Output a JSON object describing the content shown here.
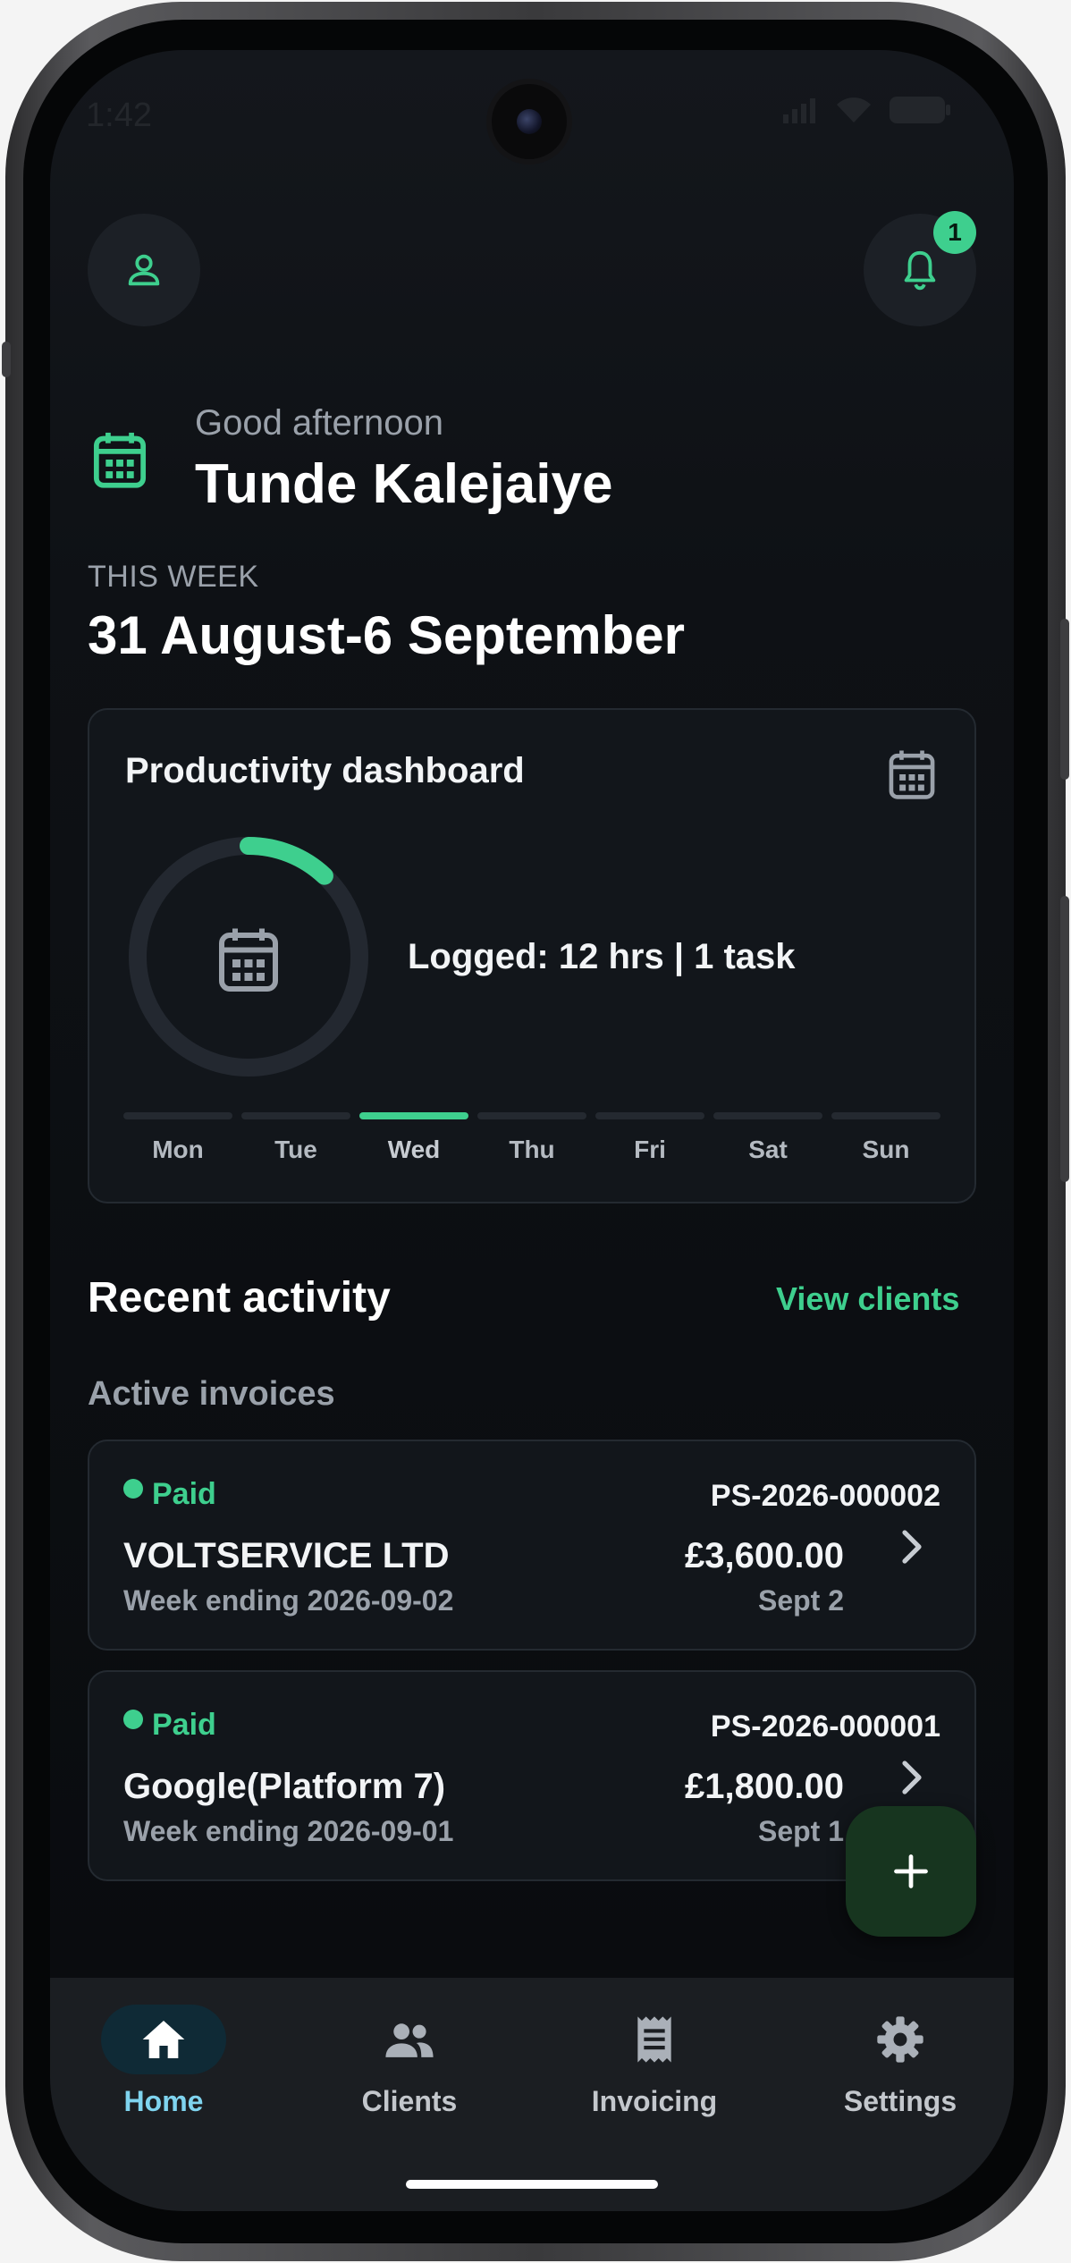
{
  "status": {
    "time": "1:42"
  },
  "header": {
    "notification_count": "1"
  },
  "greeting": {
    "salutation": "Good afternoon",
    "name": "Tunde Kalejaiye"
  },
  "week": {
    "label": "THIS WEEK",
    "range": "31 August-6 September"
  },
  "productivity": {
    "title": "Productivity dashboard",
    "logged_text": "Logged: 12 hrs | 1 task",
    "progress_fraction": 0.12,
    "days": [
      "Mon",
      "Tue",
      "Wed",
      "Thu",
      "Fri",
      "Sat",
      "Sun"
    ],
    "active_day": "Wed"
  },
  "activity": {
    "title": "Recent activity",
    "view_clients_label": "View clients",
    "invoices_heading": "Active invoices",
    "invoices": [
      {
        "status": "Paid",
        "id": "PS-2026-000002",
        "client": "VOLTSERVICE LTD",
        "amount": "£3,600.00",
        "week": "Week ending 2026-09-02",
        "date": "Sept 2"
      },
      {
        "status": "Paid",
        "id": "PS-2026-000001",
        "client": "Google(Platform 7)",
        "amount": "£1,800.00",
        "week": "Week ending 2026-09-01",
        "date": "Sept 1"
      }
    ]
  },
  "nav": {
    "items": [
      {
        "label": "Home",
        "icon": "home-icon"
      },
      {
        "label": "Clients",
        "icon": "people-icon"
      },
      {
        "label": "Invoicing",
        "icon": "receipt-icon"
      },
      {
        "label": "Settings",
        "icon": "gear-icon"
      }
    ],
    "active": "Home"
  },
  "colors": {
    "accent": "#3ecf8e",
    "background": "#0e1115",
    "card": "#12161b",
    "nav_active": "#7fd4ef"
  }
}
